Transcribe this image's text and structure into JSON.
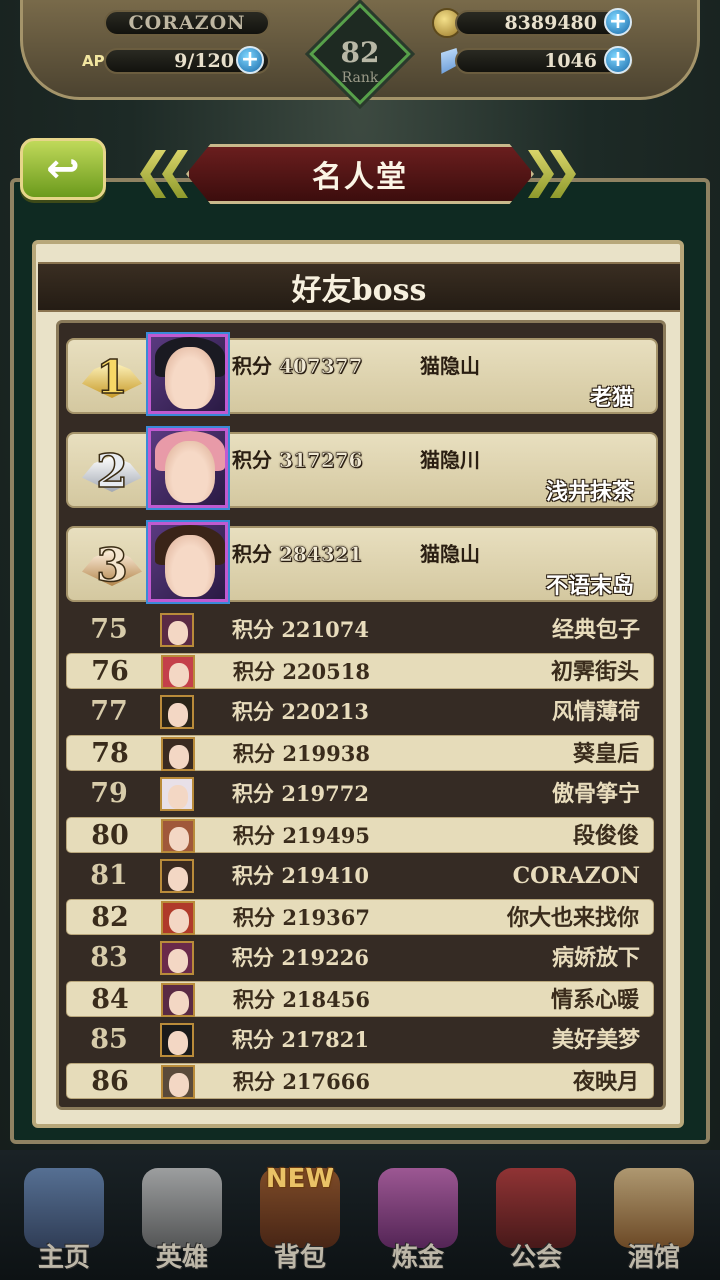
{
  "status_bar": {
    "player_name": "CORAZON",
    "ap_label": "AP",
    "ap_value": "9/120",
    "rank_number": "82",
    "rank_label": "Rank",
    "gold": "8389480",
    "gems": "1046",
    "plus_symbol": "+"
  },
  "header": {
    "back_symbol": "↩",
    "title": "名人堂"
  },
  "section": {
    "title": "好友boss"
  },
  "top_three": [
    {
      "rank": "1",
      "score_label": "积分",
      "score": "407377",
      "guild": "猫隐山",
      "name": "老猫",
      "hair": "#1a1a22"
    },
    {
      "rank": "2",
      "score_label": "积分",
      "score": "317276",
      "guild": "猫隐川",
      "name": "浅井抹茶",
      "hair": "#e89aa8"
    },
    {
      "rank": "3",
      "score_label": "积分",
      "score": "284321",
      "guild": "猫隐山",
      "name": "不语末岛",
      "hair": "#3a2418"
    }
  ],
  "rankings": [
    {
      "rank": "75",
      "score_label": "积分",
      "score": "221074",
      "name": "经典包子"
    },
    {
      "rank": "76",
      "score_label": "积分",
      "score": "220518",
      "name": "初霁街头"
    },
    {
      "rank": "77",
      "score_label": "积分",
      "score": "220213",
      "name": "风情薄荷"
    },
    {
      "rank": "78",
      "score_label": "积分",
      "score": "219938",
      "name": "葵皇后"
    },
    {
      "rank": "79",
      "score_label": "积分",
      "score": "219772",
      "name": "傲骨筝宁"
    },
    {
      "rank": "80",
      "score_label": "积分",
      "score": "219495",
      "name": "段俊俊"
    },
    {
      "rank": "81",
      "score_label": "积分",
      "score": "219410",
      "name": "CORAZON"
    },
    {
      "rank": "82",
      "score_label": "积分",
      "score": "219367",
      "name": "你大也来找你"
    },
    {
      "rank": "83",
      "score_label": "积分",
      "score": "219226",
      "name": "病娇放下"
    },
    {
      "rank": "84",
      "score_label": "积分",
      "score": "218456",
      "name": "情系心暖"
    },
    {
      "rank": "85",
      "score_label": "积分",
      "score": "217821",
      "name": "美好美梦"
    },
    {
      "rank": "86",
      "score_label": "积分",
      "score": "217666",
      "name": "夜映月"
    }
  ],
  "bottom_nav": {
    "new_badge": "NEW",
    "items": [
      {
        "label": "主页",
        "icon": "castle-icon"
      },
      {
        "label": "英雄",
        "icon": "helmet-icon"
      },
      {
        "label": "背包",
        "icon": "bag-icon"
      },
      {
        "label": "炼金",
        "icon": "potion-icon"
      },
      {
        "label": "公会",
        "icon": "shield-icon"
      },
      {
        "label": "酒馆",
        "icon": "beer-icon"
      }
    ]
  },
  "colors": {
    "title_ribbon": "#5a1616",
    "back_button": "#8fb52a",
    "board": "#352b24",
    "row_light": "#e6dcba"
  }
}
